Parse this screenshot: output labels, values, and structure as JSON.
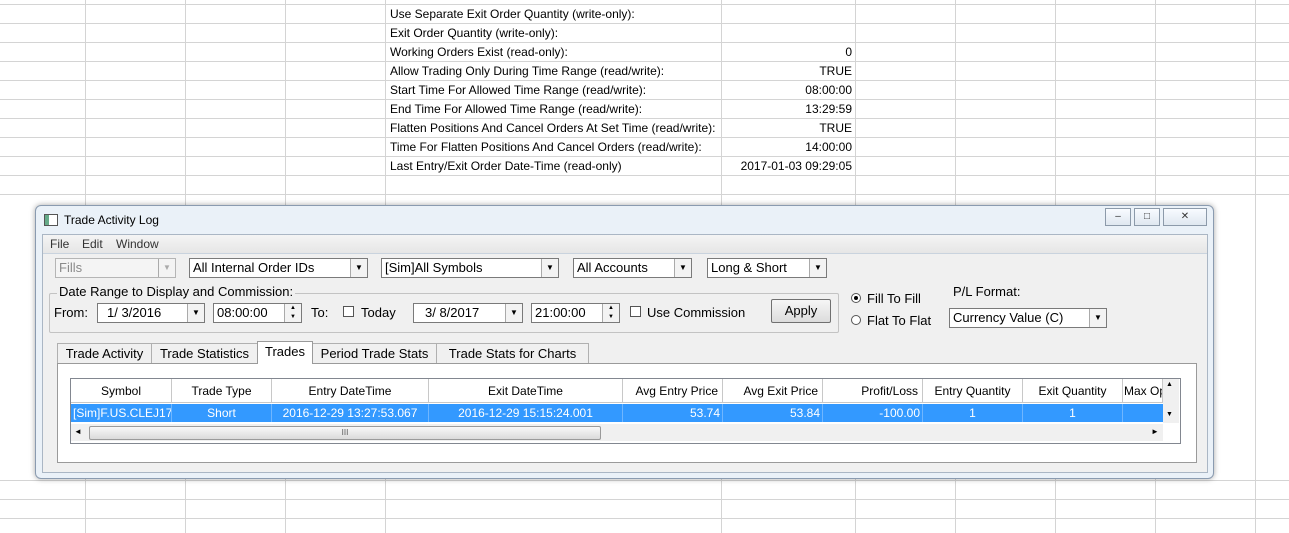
{
  "sheet": {
    "rows": [
      {
        "label": "Use Separate Exit Order Quantity (write-only):",
        "value": ""
      },
      {
        "label": "Exit Order Quantity (write-only):",
        "value": ""
      },
      {
        "label": "Working Orders Exist (read-only):",
        "value": "0"
      },
      {
        "label": "Allow Trading Only During Time Range (read/write):",
        "value": "TRUE"
      },
      {
        "label": "Start Time For Allowed Time Range (read/write):",
        "value": "08:00:00"
      },
      {
        "label": "End Time For Allowed Time Range (read/write):",
        "value": "13:29:59"
      },
      {
        "label": "Flatten Positions And Cancel Orders At Set Time (read/write):",
        "value": "TRUE"
      },
      {
        "label": "Time For Flatten Positions And Cancel Orders (read/write):",
        "value": "14:00:00"
      },
      {
        "label": "Last Entry/Exit Order Date-Time (read-only)",
        "value": "2017-01-03  09:29:05"
      }
    ]
  },
  "window": {
    "title": "Trade Activity Log",
    "minimize": "–",
    "restore": "□",
    "close": "✕",
    "menu": [
      "File",
      "Edit",
      "Window"
    ]
  },
  "filters": {
    "type": "Fills",
    "order_ids": "All Internal Order IDs",
    "symbols": "[Sim]All Symbols",
    "accounts": "All Accounts",
    "side": "Long & Short"
  },
  "date_range": {
    "group_title": "Date Range to Display and Commission:",
    "from_label": "From:",
    "from_date": "1/  3/2016",
    "from_time": "08:00:00",
    "to_label": "To:",
    "today_label": "Today",
    "to_date": "3/  8/2017",
    "to_time": "21:00:00",
    "use_commission_label": "Use Commission",
    "apply_label": "Apply"
  },
  "fill_mode": {
    "fill_to_fill": "Fill To Fill",
    "flat_to_flat": "Flat To Flat",
    "selected": "fill_to_fill"
  },
  "pl_format": {
    "label": "P/L Format:",
    "value": "Currency Value (C)"
  },
  "tabs": [
    "Trade Activity",
    "Trade Statistics",
    "Trades",
    "Period Trade Stats",
    "Trade Stats for Charts"
  ],
  "active_tab": "Trades",
  "trades_table": {
    "columns": [
      "Symbol",
      "Trade Type",
      "Entry DateTime",
      "Exit DateTime",
      "Avg Entry Price",
      "Avg Exit Price",
      "Profit/Loss",
      "Entry Quantity",
      "Exit Quantity",
      "Max Op"
    ],
    "rows": [
      [
        "[Sim]F.US.CLEJ17",
        "Short",
        "2016-12-29  13:27:53.067",
        "2016-12-29  15:15:24.001",
        "53.74",
        "53.84",
        "-100.00",
        "1",
        "1",
        ""
      ]
    ],
    "selected_color": "#3399ff"
  },
  "scroll": {
    "left": "◄",
    "right": "►",
    "up": "▲",
    "down": "▼",
    "grip": "III"
  }
}
